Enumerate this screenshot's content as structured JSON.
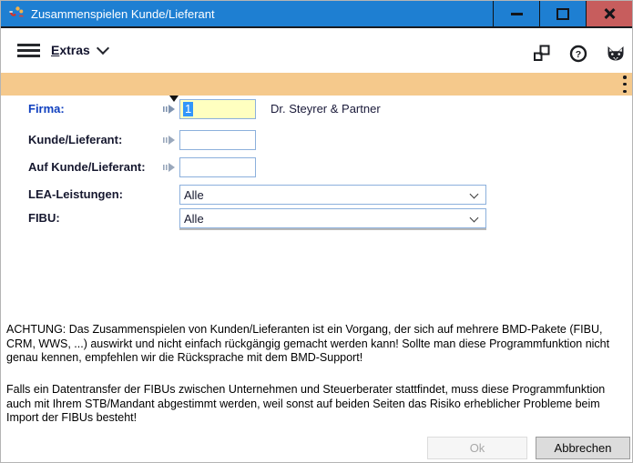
{
  "window": {
    "title": "Zusammenspielen Kunde/Lieferant"
  },
  "menubar": {
    "extras_underlined": "E",
    "extras_rest": "xtras"
  },
  "form": {
    "firma": {
      "label": "Firma:",
      "value": "1",
      "company": "Dr. Steyrer & Partner"
    },
    "kunde_lieferant": {
      "label": "Kunde/Lieferant:",
      "value": ""
    },
    "auf_kunde_lieferant": {
      "label": "Auf Kunde/Lieferant:",
      "value": ""
    },
    "lea_leistungen": {
      "label": "LEA-Leistungen:",
      "value": "Alle"
    },
    "fibu": {
      "label": "FIBU:",
      "value": "Alle"
    }
  },
  "warning": {
    "paragraph1": "ACHTUNG: Das Zusammenspielen von Kunden/Lieferanten ist ein Vorgang, der sich auf mehrere BMD-Pakete (FIBU, CRM, WWS, ...) auswirkt und nicht einfach rückgängig gemacht werden kann! Sollte man diese Programmfunktion nicht genau kennen, empfehlen wir die Rücksprache mit dem BMD-Support!",
    "paragraph2": "Falls ein Datentransfer der FIBUs zwischen Unternehmen und Steuerberater stattfindet, muss diese Programmfunktion auch mit Ihrem STB/Mandant abgestimmt werden, weil sonst auf beiden Seiten das Risiko erheblicher Probleme beim Import der FIBUs besteht!"
  },
  "buttons": {
    "ok": "Ok",
    "cancel": "Abbrechen"
  },
  "icons": {
    "app": "merge-people-magnet-icon",
    "titlebar": [
      "minimize-icon",
      "maximize-icon",
      "close-icon"
    ],
    "menubar_left": [
      "hamburger-icon",
      "chevron-down-icon"
    ],
    "menubar_right": [
      "linked-windows-icon",
      "help-icon",
      "fox-icon"
    ],
    "toolbar": [
      "kebab-menu-icon"
    ],
    "form": [
      "field-marker-triangle-icon",
      "field-arrow-icon",
      "dropdown-chevron-icon"
    ]
  },
  "colors": {
    "titlebar": "#1e7fd2",
    "close_button": "#c75d5d",
    "toolbar_orange": "#f5c98c",
    "input_border": "#8cb0dc",
    "active_field_bg": "#ffffc0",
    "selection": "#3296fa",
    "firma_label": "#0f3fbf",
    "label_dark": "#16182f"
  }
}
